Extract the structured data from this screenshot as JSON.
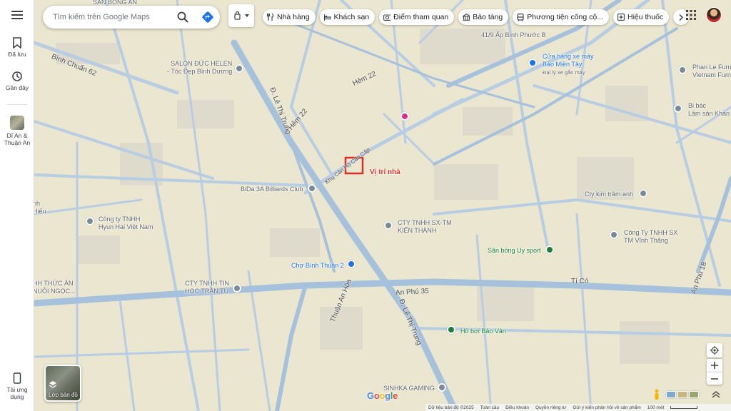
{
  "search": {
    "placeholder": "Tìm kiếm trên Google Maps"
  },
  "sidebar": {
    "saved_label": "Đã lưu",
    "recent_label": "Gần đây",
    "recent_place_label": "Dĩ An & Thuận An",
    "app_label": "Tải ứng dụng"
  },
  "chips": [
    {
      "label": "Nhà hàng",
      "icon": "fork-knife-icon"
    },
    {
      "label": "Khách sạn",
      "icon": "bed-icon"
    },
    {
      "label": "Điểm tham quan",
      "icon": "camera-icon"
    },
    {
      "label": "Bảo tàng",
      "icon": "museum-icon"
    },
    {
      "label": "Phương tiện công cộ...",
      "icon": "bus-icon"
    },
    {
      "label": "Hiệu thuốc",
      "icon": "pharmacy-icon"
    }
  ],
  "layers_button": {
    "label": "Lớp bản đồ"
  },
  "places": {
    "salon": "SALON ĐỨC HELEN\n- Tóc Đẹp Bình Dương",
    "ap_binh_phuoc": "41/9 Ấp Bình Phước B",
    "cua_hang": "Cửa hàng xe máy\nBảo Miền Tây",
    "cua_hang_sub": "Đại lý xe gắn máy",
    "phan_le": "Phan Le Furn\nVietnam Furn",
    "bi_bac": "Bi bác\nLâm sản Khản",
    "bida": "BiDa 3A Billiards Club",
    "vi_tri": "Vị trí nhà",
    "kim_tram": "Cty kim trâm anh",
    "hieu": "nh\nHiếu",
    "hyun_hai": "Công ty TNHH\nHyun Hai Việt Nam",
    "kien_thanh": "CTY TNHH SX-TM\nKIẾN THÀNH",
    "vinh_thang": "Công Ty TNHH SX\nTM Vĩnh Thăng",
    "san_bong": "Sân bóng Uy sport",
    "cho_binh_thuan": "Chợ Bình Thuận 2",
    "thuc_an": "HH THỨC ĂN\nNUÔI NGỌC...",
    "tran_tu": "CTY TNHH TIN\nHỌC TRẦN TÚ",
    "ho_boi": "Hồ bơi Bảo Vân",
    "sinhka": "SINHKA GAMING",
    "san_bong_an": "SÂN BÓNG AN"
  },
  "roads": {
    "binh_chuan": "Bình Chuẩn 62",
    "hem22a": "Hẻm 22",
    "hem22b": "Hẻm 22",
    "le_thi_trung_1": "Đ. Lê Thị Trung",
    "le_thi_trung_2": "Đ. Lê Thị Trung",
    "khu_can_ho": "Khu Căn Hộ Cao Cấp",
    "an_phu_35": "An Phú 35",
    "ti_co": "Tí Có",
    "an_phu_18": "An Phú 18",
    "thuan_an_hoa": "Thuận An Hòa"
  },
  "footer": {
    "data": "Dữ liệu bản đồ ©2025",
    "global": "Toàn cầu",
    "terms": "Điều khoản",
    "privacy": "Quyền riêng tư",
    "feedback": "Gửi ý kiến phản hồi về sản phẩm",
    "scale": "100 mét"
  },
  "logo": "Google",
  "colors": {
    "accent": "#1a73e8",
    "marker": "#d93025",
    "map_bg": "#ebe6cf",
    "road": "#a9c3de"
  }
}
